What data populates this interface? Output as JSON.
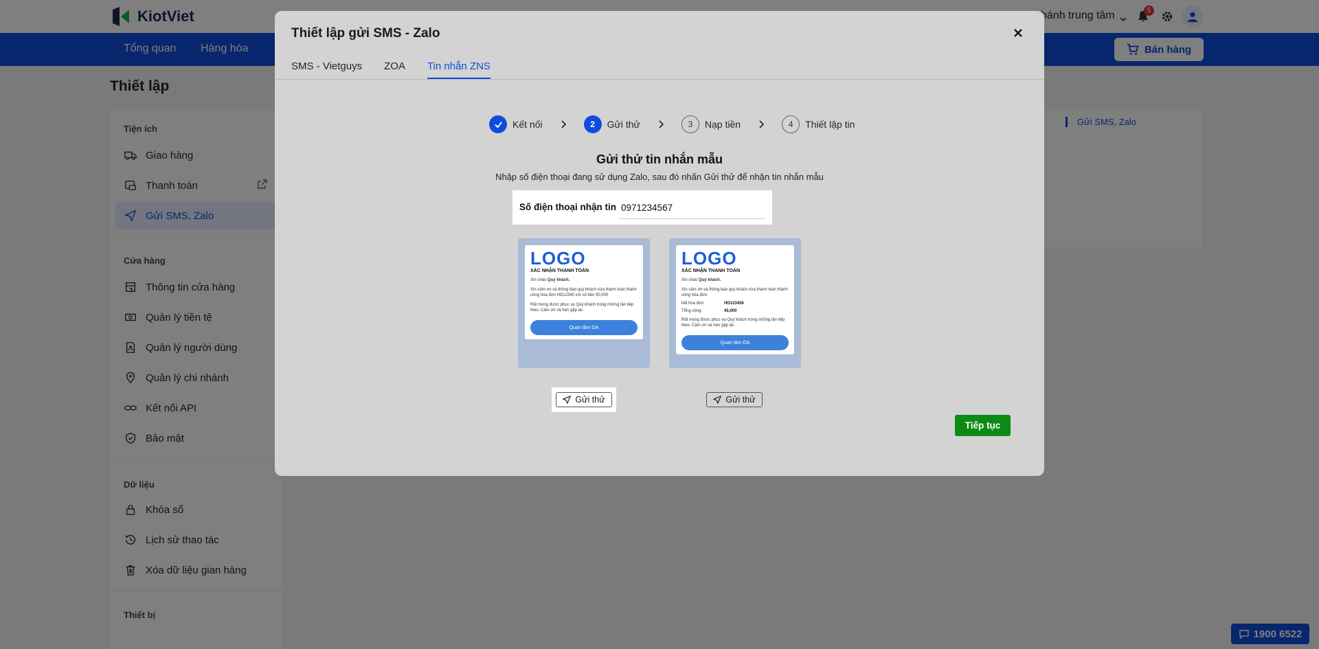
{
  "app": {
    "name": "KiotViet"
  },
  "topbar": {
    "branch": "hánh trung tâm",
    "notification_count": "5"
  },
  "nav": {
    "items": [
      "Tổng quan",
      "Hàng hóa"
    ],
    "sell_label": "Bán hàng"
  },
  "page": {
    "title": "Thiết lập"
  },
  "sidebar": {
    "sections": [
      {
        "title": "Tiện ích",
        "items": [
          "Giao hàng",
          "Thanh toán",
          "Gửi SMS, Zalo"
        ]
      },
      {
        "title": "Cửa hàng",
        "items": [
          "Thông tin cửa hàng",
          "Quản lý tiền tệ",
          "Quản lý người dùng",
          "Quản lý chi nhánh",
          "Kết nối API",
          "Bảo mật"
        ]
      },
      {
        "title": "Dữ liệu",
        "items": [
          "Khóa sổ",
          "Lịch sử thao tác",
          "Xóa dữ liệu gian hàng"
        ]
      },
      {
        "title": "Thiết bị",
        "items": []
      }
    ]
  },
  "right_nav": {
    "active": "Gửi SMS, Zalo"
  },
  "hotline": "1900 6522",
  "modal": {
    "title": "Thiết lập gửi SMS - Zalo",
    "tabs": [
      "SMS - Vietguys",
      "ZOA",
      "Tin nhắn ZNS"
    ],
    "active_tab": "Tin nhắn ZNS",
    "steps": [
      {
        "num": "1",
        "label": "Kết nối",
        "state": "done"
      },
      {
        "num": "2",
        "label": "Gửi thử",
        "state": "active"
      },
      {
        "num": "3",
        "label": "Nạp tiền",
        "state": "todo"
      },
      {
        "num": "4",
        "label": "Thiết lập tin",
        "state": "todo"
      }
    ],
    "heading": "Gửi thử tin nhắn mẫu",
    "subheading": "Nhập số điện thoại đang sử dụng Zalo, sau đó nhấn Gửi thử để nhận tin nhắn mẫu",
    "phone_label": "Số điện thoại nhận tin",
    "phone_value": "0971234567",
    "templates": [
      {
        "logo": "LOGO",
        "subtitle": "XÁC NHẬN THANH TOÁN",
        "greeting_prefix": "Xin chào ",
        "greeting_name": "Quý khách.",
        "line1": "Xin cảm ơn và thông báo quý khách vừa thanh toán thành công hóa đơn HD12345 với số tiền 50,000",
        "line2": "Rất mong được phục vụ Quý khách trong những lần tiếp theo. Cảm ơn và hẹn gặp lại.",
        "button": "Quan tâm OA"
      },
      {
        "logo": "LOGO",
        "subtitle": "XÁC NHẬN THANH TOÁN",
        "greeting_prefix": "Xin chào ",
        "greeting_name": "Quý khách.",
        "line1": "Xin cảm ơn và thông báo quý khách vừa thanh toán thành công hóa đơn:",
        "kv": [
          {
            "k": "Mã hóa đơn:",
            "v": "HD123456"
          },
          {
            "k": "Tổng cộng:",
            "v": "45,000"
          }
        ],
        "line2": "Rất mong được phục vụ Quý khách trong những lần tiếp theo. Cảm ơn và hẹn gặp lại.",
        "button": "Quan tâm OA"
      }
    ],
    "send_label": "Gửi thử",
    "continue_label": "Tiếp tục"
  },
  "colors": {
    "brand": "#0f4cdd",
    "success": "#0b8b14",
    "overlay": "rgba(0,0,0,0.5)"
  }
}
